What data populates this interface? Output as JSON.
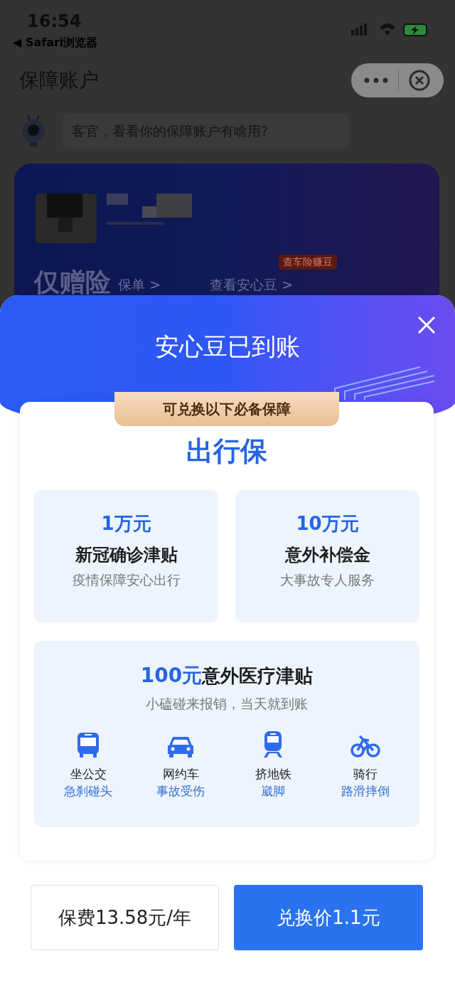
{
  "status_bar": {
    "time": "16:54",
    "back_app": "◀ Safari浏览器"
  },
  "header": {
    "title": "保障账户"
  },
  "tip": {
    "text": "客官，看看你的保障账户有啥用?"
  },
  "account_card": {
    "product": "仅赠险",
    "policy_link": "保单 >",
    "beans_link": "查看安心豆 >",
    "badge": "查车险赚豆"
  },
  "modal": {
    "title": "安心豆已到账",
    "ribbon": "可兑换以下必备保障",
    "plan": "出行保",
    "benefits": [
      {
        "amount": "1万元",
        "name": "新冠确诊津贴",
        "desc": "疫情保障安心出行"
      },
      {
        "amount": "10万元",
        "name": "意外补偿金",
        "desc": "大事故专人服务"
      }
    ],
    "medical": {
      "amount": "100元",
      "name": "意外医疗津贴",
      "desc": "小磕碰来报销，当天就到账",
      "scenes": [
        {
          "kind": "bus",
          "name": "坐公交",
          "risk": "急刹碰头"
        },
        {
          "kind": "car",
          "name": "网约车",
          "risk": "事故受伤"
        },
        {
          "kind": "metro",
          "name": "挤地铁",
          "risk": "崴脚"
        },
        {
          "kind": "bike",
          "name": "骑行",
          "risk": "路滑摔倒"
        }
      ]
    },
    "premium": "保费13.58元/年",
    "exchange_button": "兑换价1.1元"
  }
}
